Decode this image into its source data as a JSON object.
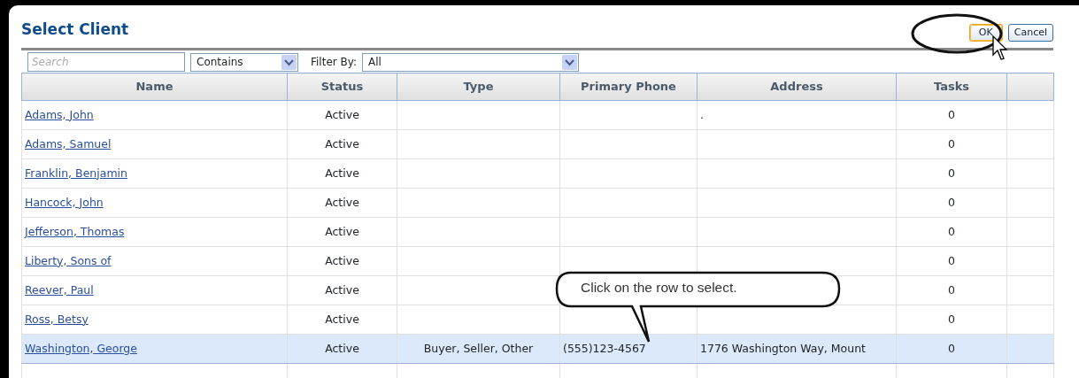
{
  "dialog": {
    "title": "Select Client",
    "buttons": [
      {
        "label": "OK",
        "kind": "primary"
      },
      {
        "label": "Cancel",
        "kind": "secondary"
      }
    ]
  },
  "toolbar": {
    "search": {
      "placeholder": "Search"
    },
    "match": {
      "value": "Contains"
    },
    "filter_label": "Filter By:",
    "filter": {
      "value": "All"
    }
  },
  "table": {
    "columns": [
      "Name",
      "Status",
      "Type",
      "Primary Phone",
      "Address",
      "Tasks"
    ],
    "rows": [
      {
        "name": "Adams, John",
        "status": "Active",
        "type": "",
        "phone": "",
        "address": ".",
        "tasks": "0",
        "selected": false
      },
      {
        "name": "Adams, Samuel",
        "status": "Active",
        "type": "",
        "phone": "",
        "address": "",
        "tasks": "0",
        "selected": false
      },
      {
        "name": "Franklin, Benjamin",
        "status": "Active",
        "type": "",
        "phone": "",
        "address": "",
        "tasks": "0",
        "selected": false
      },
      {
        "name": "Hancock, John",
        "status": "Active",
        "type": "",
        "phone": "",
        "address": "",
        "tasks": "0",
        "selected": false
      },
      {
        "name": "Jefferson, Thomas",
        "status": "Active",
        "type": "",
        "phone": "",
        "address": "",
        "tasks": "0",
        "selected": false
      },
      {
        "name": "Liberty, Sons of",
        "status": "Active",
        "type": "",
        "phone": "",
        "address": "",
        "tasks": "0",
        "selected": false
      },
      {
        "name": "Reever, Paul",
        "status": "Active",
        "type": "",
        "phone": "",
        "address": "",
        "tasks": "0",
        "selected": false
      },
      {
        "name": "Ross, Betsy",
        "status": "Active",
        "type": "",
        "phone": "",
        "address": "",
        "tasks": "0",
        "selected": false
      },
      {
        "name": "Washington, George",
        "status": "Active",
        "type": "Buyer, Seller, Other",
        "phone": "(555)123-4567",
        "address": "1776 Washington Way, Mount",
        "tasks": "0",
        "selected": true
      }
    ]
  },
  "callout": {
    "text": "Click on the row to select."
  }
}
